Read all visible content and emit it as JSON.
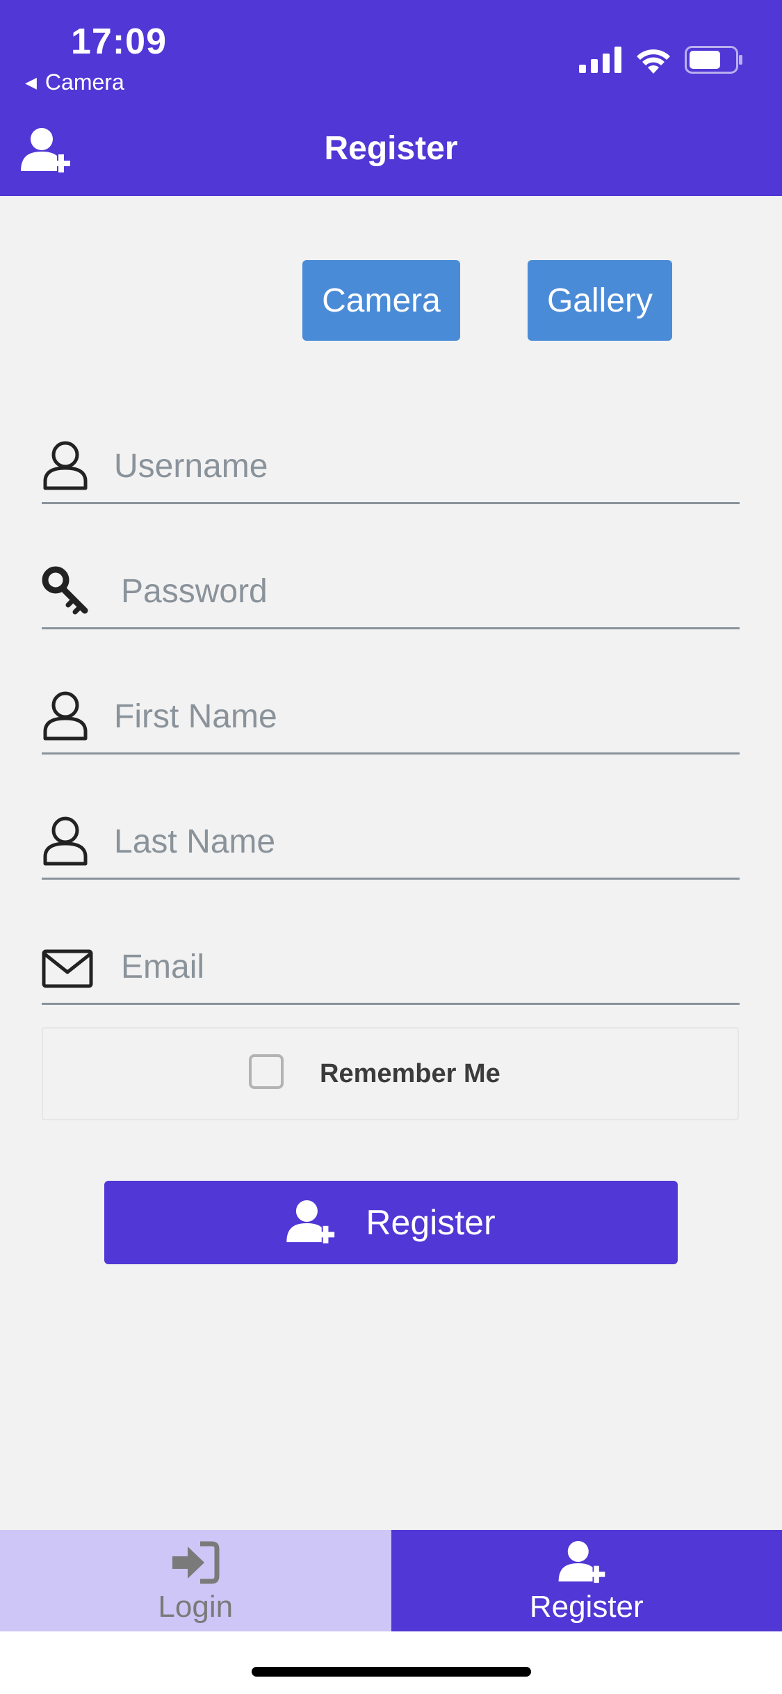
{
  "status_bar": {
    "time": "17:09",
    "back_app": "Camera"
  },
  "header": {
    "title": "Register",
    "icon": "user-plus-icon"
  },
  "photo_buttons": {
    "camera": "Camera",
    "gallery": "Gallery"
  },
  "form": {
    "fields": [
      {
        "placeholder": "Username",
        "icon": "user-icon",
        "value": ""
      },
      {
        "placeholder": "Password",
        "icon": "key-icon",
        "value": ""
      },
      {
        "placeholder": "First Name",
        "icon": "user-icon",
        "value": ""
      },
      {
        "placeholder": "Last Name",
        "icon": "user-icon",
        "value": ""
      },
      {
        "placeholder": "Email",
        "icon": "envelope-icon",
        "value": ""
      }
    ],
    "remember_me": {
      "label": "Remember Me",
      "checked": false
    },
    "submit_label": "Register"
  },
  "tabs": [
    {
      "label": "Login",
      "icon": "sign-in-icon",
      "active": false
    },
    {
      "label": "Register",
      "icon": "user-plus-icon",
      "active": true
    }
  ],
  "colors": {
    "primary": "#5137d5",
    "photo_button": "#4a8bd8",
    "inactive_tab": "#cdc6f7",
    "background": "#f2f2f2"
  }
}
